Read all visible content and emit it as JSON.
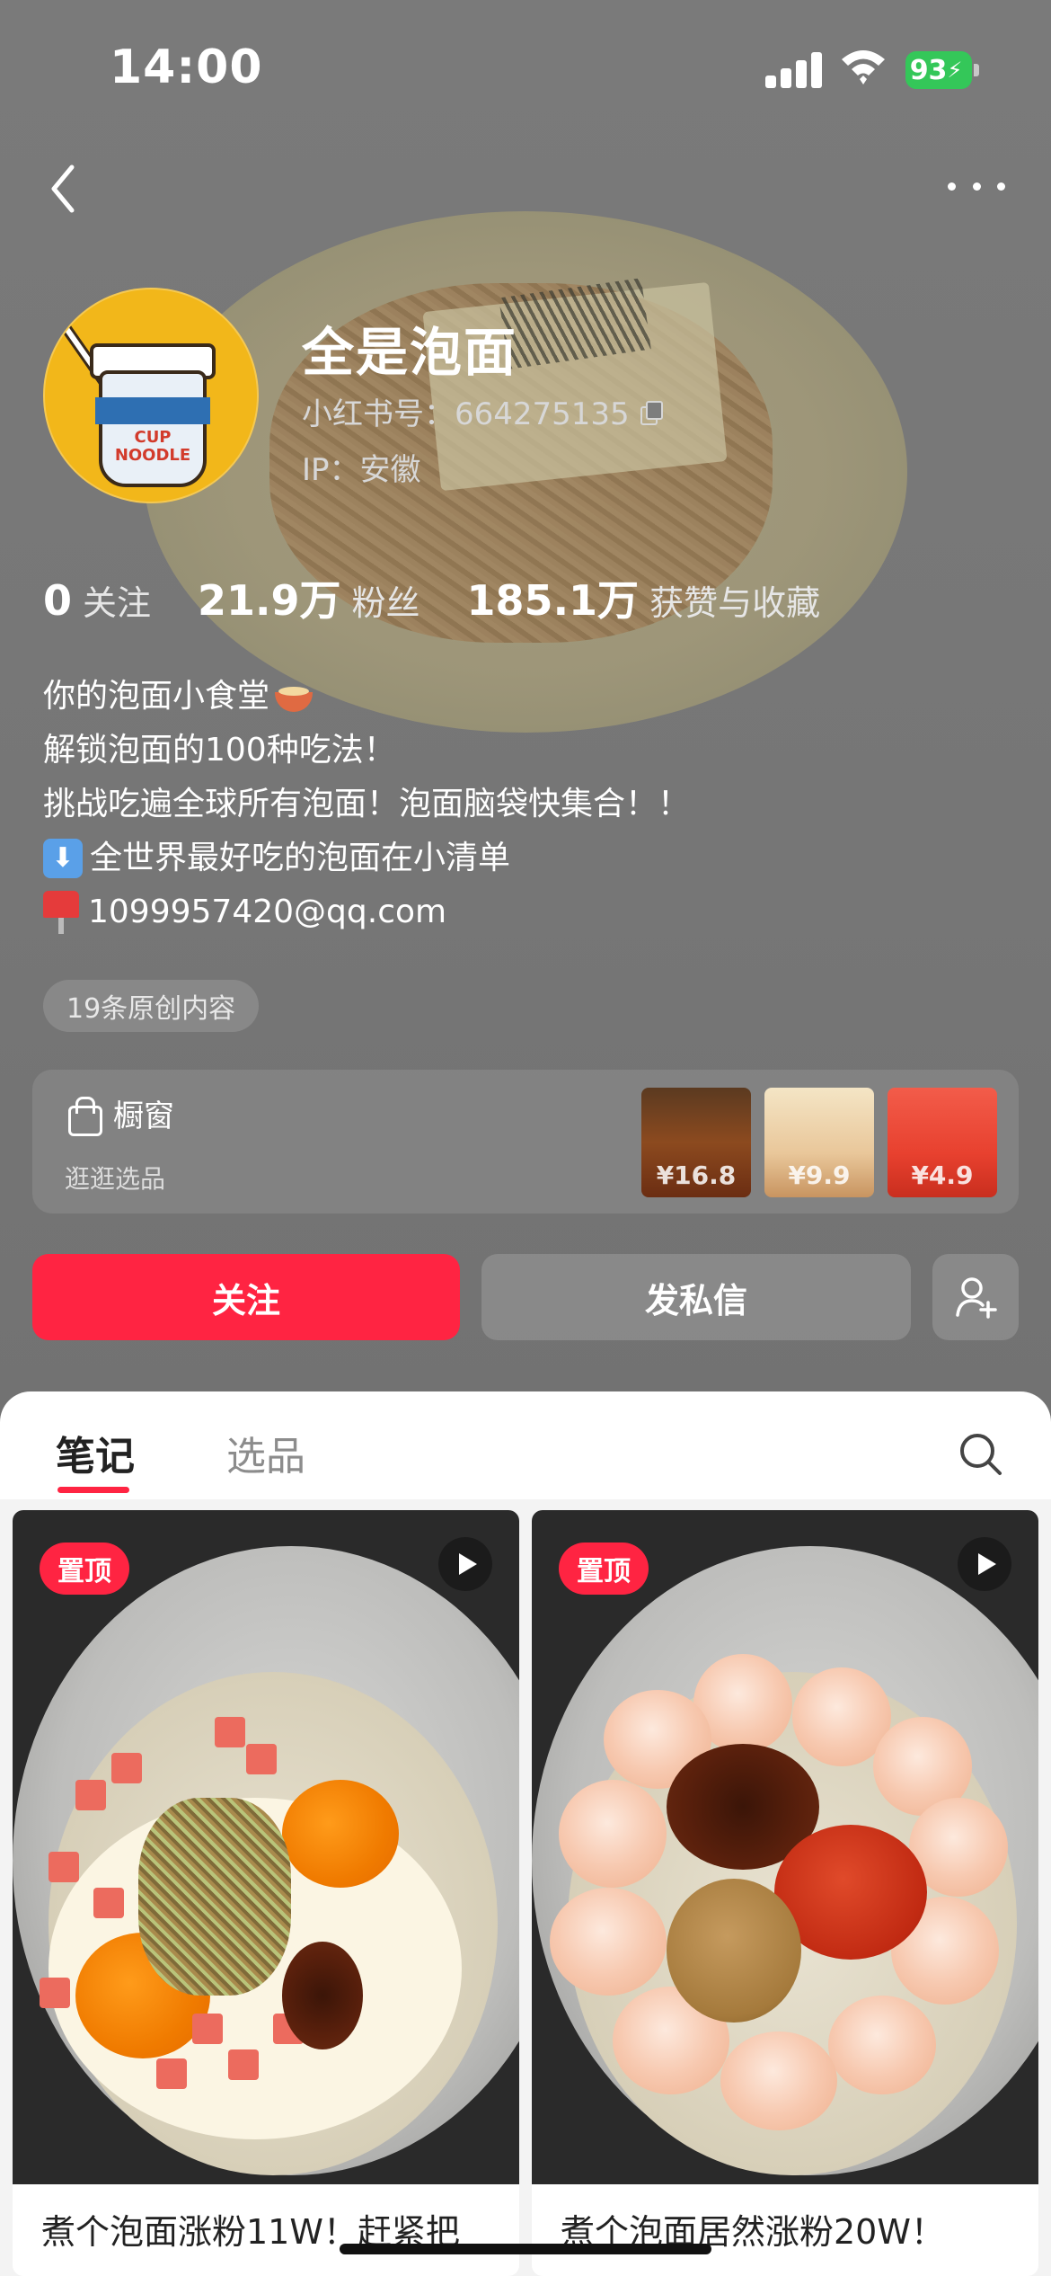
{
  "status_bar": {
    "time": "14:00",
    "battery": "93"
  },
  "profile": {
    "name": "全是泡面",
    "id_text": "小红书号：664275135",
    "ip_text": "IP：安徽"
  },
  "stats": [
    {
      "value": "0",
      "label": "关注"
    },
    {
      "value": "21.9万",
      "label": "粉丝"
    },
    {
      "value": "185.1万",
      "label": "获赞与收藏"
    }
  ],
  "bio": [
    "你的泡面小食堂",
    "解锁泡面的100种吃法！",
    "挑战吃遍全球所有泡面！泡面脑袋快集合！！",
    "全世界最好吃的泡面在小清单",
    "1099957420@qq.com"
  ],
  "original_badge": "19条原创内容",
  "shop": {
    "title": "橱窗",
    "subtitle": "逛逛选品",
    "items": [
      {
        "price": "¥16.8"
      },
      {
        "price": "¥9.9"
      },
      {
        "price": "¥4.9"
      }
    ]
  },
  "actions": {
    "follow": "关注",
    "message": "发私信"
  },
  "tabs": [
    {
      "label": "笔记"
    },
    {
      "label": "选品"
    }
  ],
  "notes": [
    {
      "badge": "置顶",
      "title": "煮个泡面涨粉11W！赶紧把"
    },
    {
      "badge": "置顶",
      "title": "煮个泡面居然涨粉20W！"
    }
  ],
  "colors": {
    "accent": "#ff2442",
    "battery": "#34c759"
  }
}
